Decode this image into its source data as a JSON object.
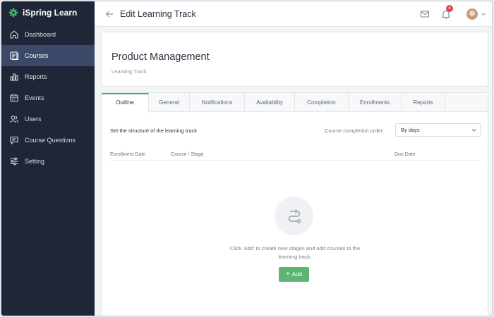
{
  "app": {
    "name": "iSpring Learn"
  },
  "sidebar": {
    "items": [
      {
        "label": "Dashboard",
        "icon": "home-icon"
      },
      {
        "label": "Courses",
        "icon": "courses-icon",
        "active": true
      },
      {
        "label": "Reports",
        "icon": "bar-chart-icon"
      },
      {
        "label": "Events",
        "icon": "calendar-icon"
      },
      {
        "label": "Users",
        "icon": "users-icon"
      },
      {
        "label": "Course Questions",
        "icon": "message-icon"
      },
      {
        "label": "Setting",
        "icon": "sliders-icon"
      }
    ]
  },
  "header": {
    "title": "Edit Learning Track",
    "notifications_count": "4"
  },
  "course": {
    "title": "Product Management",
    "subtitle": "Learning Track"
  },
  "tabs": [
    {
      "label": "Outline",
      "active": true
    },
    {
      "label": "General"
    },
    {
      "label": "Notifications"
    },
    {
      "label": "Availability"
    },
    {
      "label": "Completion"
    },
    {
      "label": "Enrollments"
    },
    {
      "label": "Reports"
    }
  ],
  "outline": {
    "structure_label": "Set the structure of the learning track",
    "completion_order_label": "Course completion order:",
    "completion_order_value": "By days",
    "columns": [
      "Enrollment Date",
      "Course / Stage",
      "Due Date"
    ],
    "empty_text": "Click 'Add' to create new stages and add courses to the learning track.",
    "add_label": "Add"
  },
  "colors": {
    "sidebar_bg": "#1f2638",
    "sidebar_active": "#3b4867",
    "accent_green": "#5cb572",
    "badge_red": "#e04848"
  }
}
